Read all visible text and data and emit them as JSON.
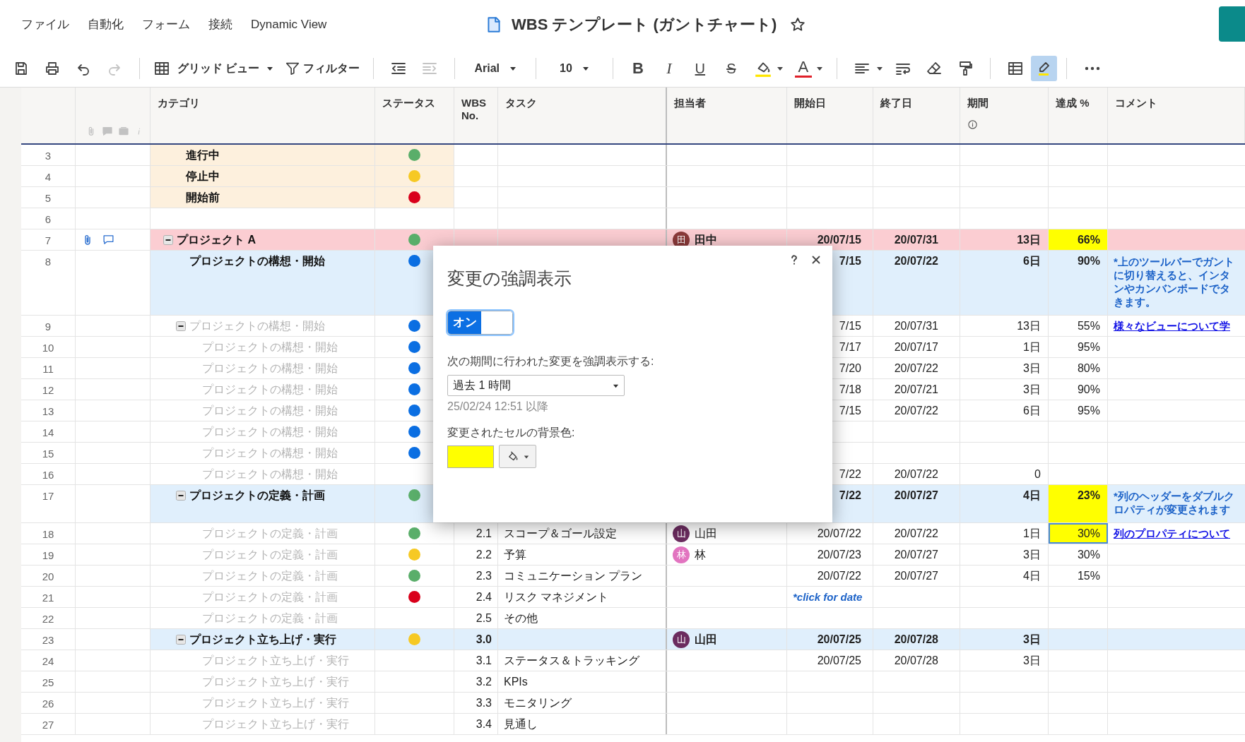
{
  "menu": [
    {
      "label": "ファイル"
    },
    {
      "label": "自動化"
    },
    {
      "label": "フォーム"
    },
    {
      "label": "接続"
    },
    {
      "label": "Dynamic View"
    }
  ],
  "document": {
    "title": "WBS テンプレート (ガントチャート)",
    "starred": false
  },
  "toolbar": {
    "view": "グリッド ビュー",
    "filter": "フィルター",
    "font": "Arial",
    "font_size": "10",
    "bold": "B",
    "italic": "I",
    "underline": "U",
    "strike": "S",
    "text_color": "A",
    "redo_disabled": true,
    "indent_disabled": true,
    "highlight_active": true
  },
  "columns": [
    {
      "label": "カテゴリ"
    },
    {
      "label": "ステータス"
    },
    {
      "label": "WBS No."
    },
    {
      "label": "タスク"
    },
    {
      "label": "担当者"
    },
    {
      "label": "開始日"
    },
    {
      "label": "終了日"
    },
    {
      "label": "期間",
      "info": true
    },
    {
      "label": "達成 %"
    },
    {
      "label": "コメント"
    }
  ],
  "rows": [
    {
      "number": "3",
      "kind": "legend",
      "color": "#fdf0dd",
      "category": "進行中",
      "status": {
        "color": "#5aae6a"
      }
    },
    {
      "number": "4",
      "kind": "legend",
      "color": "#fdf0dd",
      "category": "停止中",
      "status": {
        "color": "#f6c924"
      }
    },
    {
      "number": "5",
      "kind": "legend",
      "color": "#fdf0dd",
      "category": "開始前",
      "status": {
        "color": "#d9001b"
      }
    },
    {
      "number": "6",
      "kind": "blank"
    },
    {
      "number": "7",
      "kind": "summary",
      "color": "#fbcdd2",
      "attachment": true,
      "comment_icon": true,
      "category": "プロジェクト A",
      "expanded": true,
      "status": {
        "color": "#5aae6a"
      },
      "assignee": {
        "initial": "田",
        "name": "田中",
        "color": "#8b3a3a"
      },
      "start": "20/07/15",
      "end": "20/07/31",
      "duration": "13日",
      "percent": {
        "text": "66%",
        "changed": true,
        "selected": false
      },
      "children": [
        {
          "number": "8",
          "kind": "summary",
          "color": "#e0effc",
          "category": "プロジェクトの構想・開始",
          "status": {
            "color": "#0b6fe3"
          },
          "start": "7/15",
          "end": "20/07/22",
          "duration": "6日",
          "percent": {
            "text": "90%",
            "changed": false,
            "selected": false
          },
          "comment": {
            "kind": "note",
            "lines": [
              "*上のツールバーでガント",
              "に切り替えると、インタ",
              "ンやカンバンボードでタ",
              "きます。"
            ]
          }
        },
        {
          "number": "9",
          "kind": "task",
          "category": "プロジェクトの構想・開始",
          "expanded": true,
          "status": {
            "color": "#0b6fe3"
          },
          "start": "7/15",
          "end": "20/07/31",
          "duration": "13日",
          "percent": {
            "text": "55%",
            "changed": false,
            "selected": false
          },
          "comment": {
            "kind": "link",
            "text": "様々なビューについて学"
          },
          "children": [
            {
              "number": "10",
              "kind": "task",
              "category": "プロジェクトの構想・開始",
              "status": {
                "color": "#0b6fe3"
              },
              "start": "7/17",
              "end": "20/07/17",
              "duration": "1日",
              "percent": {
                "text": "95%",
                "changed": false,
                "selected": false
              }
            },
            {
              "number": "11",
              "kind": "task",
              "category": "プロジェクトの構想・開始",
              "status": {
                "color": "#0b6fe3"
              },
              "start": "7/20",
              "end": "20/07/22",
              "duration": "3日",
              "percent": {
                "text": "80%",
                "changed": false,
                "selected": false
              }
            },
            {
              "number": "12",
              "kind": "task",
              "category": "プロジェクトの構想・開始",
              "status": {
                "color": "#0b6fe3"
              },
              "start": "7/18",
              "end": "20/07/21",
              "duration": "3日",
              "percent": {
                "text": "90%",
                "changed": false,
                "selected": false
              }
            },
            {
              "number": "13",
              "kind": "task",
              "category": "プロジェクトの構想・開始",
              "status": {
                "color": "#0b6fe3"
              },
              "start": "7/15",
              "end": "20/07/22",
              "duration": "6日",
              "percent": {
                "text": "95%",
                "changed": false,
                "selected": false
              }
            },
            {
              "number": "14",
              "kind": "task",
              "category": "プロジェクトの構想・開始",
              "status": {
                "color": "#0b6fe3"
              }
            },
            {
              "number": "15",
              "kind": "task",
              "category": "プロジェクトの構想・開始",
              "status": {
                "color": "#0b6fe3"
              }
            },
            {
              "number": "16",
              "kind": "task",
              "category": "プロジェクトの構想・開始",
              "start": "7/22",
              "end": "20/07/22",
              "duration": "0"
            }
          ]
        },
        {
          "number": "17",
          "kind": "summary",
          "color": "#e0effc",
          "category": "プロジェクトの定義・計画",
          "expanded": true,
          "status": {
            "color": "#5aae6a"
          },
          "start": "7/22",
          "end": "20/07/27",
          "duration": "4日",
          "percent": {
            "text": "23%",
            "changed": true,
            "selected": false
          },
          "comment": {
            "kind": "note",
            "lines": [
              "*列のヘッダーをダブルク",
              "ロパティが変更されます"
            ]
          },
          "children": [
            {
              "number": "18",
              "kind": "task",
              "category": "プロジェクトの定義・計画",
              "status": {
                "color": "#5aae6a"
              },
              "wbs": "2.1",
              "task": "スコープ＆ゴール設定",
              "assignee": {
                "initial": "山",
                "name": "山田",
                "color": "#6b2c5f"
              },
              "start": "20/07/22",
              "end": "20/07/22",
              "duration": "1日",
              "percent": {
                "text": "30%",
                "changed": true,
                "selected": true
              },
              "comment": {
                "kind": "link",
                "text": "列のプロパティについて"
              }
            },
            {
              "number": "19",
              "kind": "task",
              "category": "プロジェクトの定義・計画",
              "status": {
                "color": "#f6c924"
              },
              "wbs": "2.2",
              "task": "予算",
              "assignee": {
                "initial": "林",
                "name": "林",
                "color": "#e274c0"
              },
              "start": "20/07/23",
              "end": "20/07/27",
              "duration": "3日",
              "percent": {
                "text": "30%",
                "changed": false,
                "selected": false
              }
            },
            {
              "number": "20",
              "kind": "task",
              "category": "プロジェクトの定義・計画",
              "status": {
                "color": "#5aae6a"
              },
              "wbs": "2.3",
              "task": "コミュニケーション プラン",
              "start": "20/07/22",
              "end": "20/07/27",
              "duration": "4日",
              "percent": {
                "text": "15%",
                "changed": false,
                "selected": false
              }
            },
            {
              "number": "21",
              "kind": "task",
              "category": "プロジェクトの定義・計画",
              "status": {
                "color": "#d9001b"
              },
              "wbs": "2.4",
              "task": "リスク マネジメント",
              "start_prompt": "*click for date"
            },
            {
              "number": "22",
              "kind": "task",
              "category": "プロジェクトの定義・計画",
              "wbs": "2.5",
              "task": "その他"
            }
          ]
        },
        {
          "number": "23",
          "kind": "summary",
          "color": "#e0effc",
          "category": "プロジェクト立ち上げ・実行",
          "expanded": true,
          "status": {
            "color": "#f6c924"
          },
          "wbs": "3.0",
          "assignee": {
            "initial": "山",
            "name": "山田",
            "color": "#6b2c5f"
          },
          "start": "20/07/25",
          "end": "20/07/28",
          "duration": "3日",
          "children": [
            {
              "number": "24",
              "kind": "task",
              "category": "プロジェクト立ち上げ・実行",
              "wbs": "3.1",
              "task": "ステータス＆トラッキング",
              "start": "20/07/25",
              "end": "20/07/28",
              "duration": "3日"
            },
            {
              "number": "25",
              "kind": "task",
              "category": "プロジェクト立ち上げ・実行",
              "wbs": "3.2",
              "task": "KPIs"
            },
            {
              "number": "26",
              "kind": "task",
              "category": "プロジェクト立ち上げ・実行",
              "wbs": "3.3",
              "task": "モニタリング"
            },
            {
              "number": "27",
              "kind": "task",
              "category": "プロジェクト立ち上げ・実行",
              "wbs": "3.4",
              "task": "見通し"
            }
          ]
        }
      ]
    }
  ],
  "dialog": {
    "title": "変更の強調表示",
    "toggle": {
      "label": "オン",
      "on": true
    },
    "period_label": "次の期間に行われた変更を強調表示する:",
    "period": "過去 1 時間",
    "since": "25/02/24 12:51 以降",
    "color_label": "変更されたセルの背景色:",
    "color": "#ffff00"
  }
}
